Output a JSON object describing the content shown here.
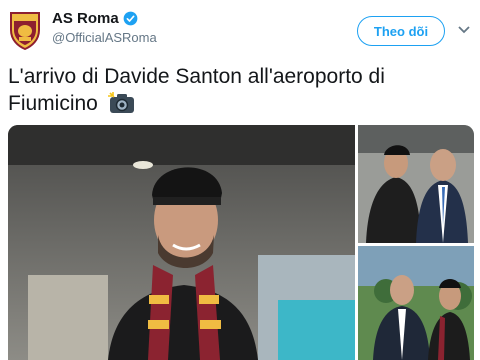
{
  "account": {
    "display_name": "AS Roma",
    "handle": "@OfficialASRoma",
    "verified": true,
    "avatar_icon": "as-roma-crest-icon"
  },
  "actions": {
    "follow_label": "Theo dõi",
    "menu_icon": "chevron-down-icon"
  },
  "tweet": {
    "text": "L'arrivo di Davide Santon all'aeroporto di Fiumicino",
    "emoji_icon": "camera-flash-icon"
  },
  "media": {
    "photos": [
      {
        "description_icon": "photo-main"
      },
      {
        "description_icon": "photo-top-right"
      },
      {
        "description_icon": "photo-bottom-right"
      }
    ]
  },
  "colors": {
    "accent": "#1da1f2",
    "roma_red": "#8e1f2f",
    "roma_gold": "#f0bc42",
    "text": "#14171a",
    "muted": "#657786"
  }
}
